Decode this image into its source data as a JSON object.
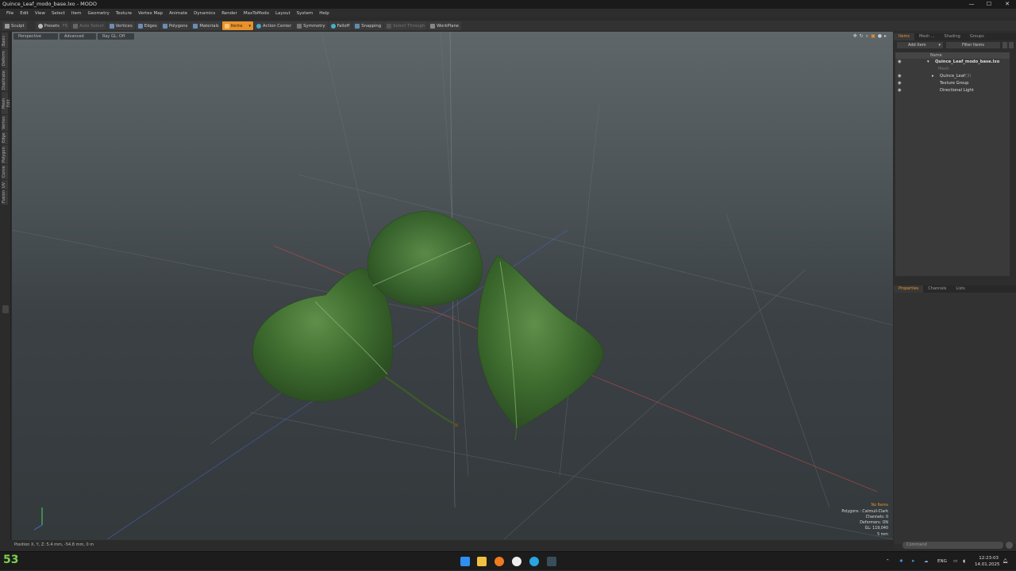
{
  "window": {
    "title": "Quince_Leaf_modo_base.lxo - MODO",
    "minimize": "—",
    "maximize": "☐",
    "close": "✕"
  },
  "menu": [
    "File",
    "Edit",
    "View",
    "Select",
    "Item",
    "Geometry",
    "Texture",
    "Vertex Map",
    "Animate",
    "Dynamics",
    "Render",
    "MaxToModo",
    "Layout",
    "System",
    "Help"
  ],
  "toolbar": {
    "sculpt": "Sculpt",
    "presets": "Presets",
    "presets_key": "F6",
    "auto_select": "Auto Select",
    "vertices": "Vertices",
    "edges": "Edges",
    "polygons": "Polygons",
    "materials": "Materials",
    "items": "Items",
    "action_center": "Action Center",
    "symmetry": "Symmetry",
    "falloff": "Falloff",
    "snapping": "Snapping",
    "select_through": "Select Through",
    "workplane": "WorkPlane"
  },
  "left_tabs": [
    "Basic",
    "Deform",
    "Duplicate",
    "Mesh Edit",
    "Vertex",
    "Edge",
    "Polygon",
    "Curve",
    "UV",
    "Fusion"
  ],
  "viewport": {
    "tab_perspective": "Perspective",
    "tab_advanced": "Advanced",
    "tab_raygl": "Ray GL: Off",
    "info_noitems": "No Items",
    "info_polygons": "Polygons : Catmull-Clark",
    "info_channels": "Channels: 0",
    "info_deformers": "Deformers: ON",
    "info_gl": "GL: 119,040",
    "info_unit": "5 mm"
  },
  "status": {
    "position": "Position X, Y, Z:   5.4 mm, -54.8 mm, 0 m"
  },
  "right_panel": {
    "tabs": [
      "Items",
      "Mesh ...",
      "Shading",
      "Groups"
    ],
    "add_item": "Add Item",
    "filter_items": "Filter Items",
    "col_name": "Name",
    "items": [
      {
        "label": "Quince_Leaf_modo_base.lxo",
        "bold": true
      },
      {
        "label": "Mesh",
        "dim": true
      },
      {
        "label": "Quince_Leaf",
        "suffix": "(3)"
      },
      {
        "label": "Texture Group"
      },
      {
        "label": "Directional Light"
      }
    ],
    "prop_tabs": [
      "Properties",
      "Channels",
      "Lists"
    ],
    "command_placeholder": "Command"
  },
  "taskbar": {
    "fps": "53",
    "lang": "ENG",
    "time": "12:23:03",
    "date": "14.01.2025"
  },
  "colors": {
    "accent": "#e8922a",
    "leaf_dark": "#2f5a24",
    "leaf_light": "#5f8f4a"
  }
}
